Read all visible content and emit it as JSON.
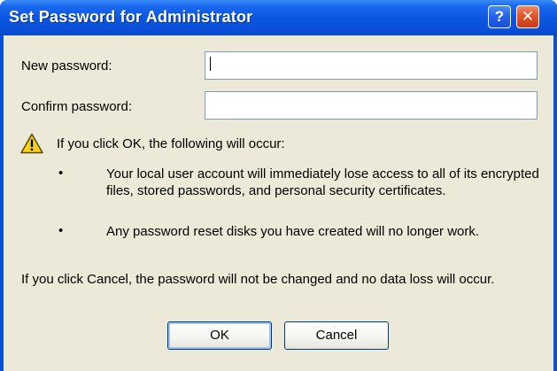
{
  "window": {
    "title": "Set Password for Administrator",
    "help_label": "?",
    "close_label": "✕"
  },
  "form": {
    "new_password_label": "New password:",
    "new_password_value": "",
    "confirm_password_label": "Confirm password:",
    "confirm_password_value": ""
  },
  "warning": {
    "icon": "warning-triangle-icon",
    "intro": "If you click OK, the following will occur:",
    "bullet_symbol": "•",
    "items": [
      "Your local user account will immediately lose access to all of its encrypted files, stored passwords, and personal security certificates.",
      "Any password reset disks you have created will no longer work."
    ]
  },
  "cancel_note": "If you click Cancel, the password will not be changed and no data loss will occur.",
  "buttons": {
    "ok": "OK",
    "cancel": "Cancel"
  },
  "colors": {
    "titlebar": "#0a55e0",
    "dialog_background": "#ece9d8",
    "close_button": "#e2552b",
    "textbox_border": "#7f9db9"
  }
}
